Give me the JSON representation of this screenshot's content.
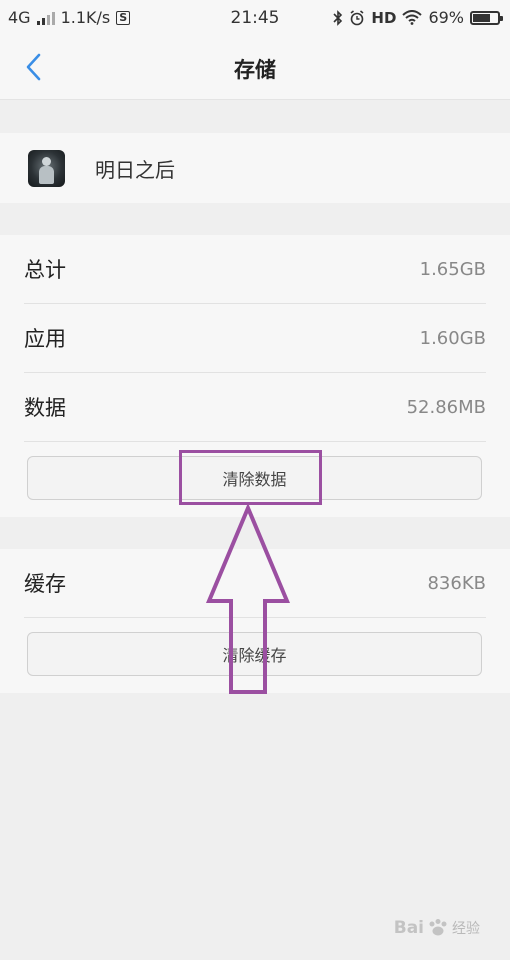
{
  "status_bar": {
    "network": "4G",
    "speed": "1.1K/s",
    "sync_glyph": "S",
    "time": "21:45",
    "hd": "HD",
    "battery_pct": "69%",
    "battery_level": 0.69
  },
  "nav": {
    "title": "存储"
  },
  "app": {
    "name": "明日之后"
  },
  "storage": {
    "rows": [
      {
        "label": "总计",
        "value": "1.65GB"
      },
      {
        "label": "应用",
        "value": "1.60GB"
      },
      {
        "label": "数据",
        "value": "52.86MB"
      }
    ],
    "clear_data_label": "清除数据"
  },
  "cache": {
    "label": "缓存",
    "value": "836KB",
    "clear_cache_label": "清除缓存"
  },
  "watermark": {
    "text": "Bai",
    "text2": "经验"
  },
  "colors": {
    "accent": "#3a8ee6",
    "annotation": "#9b4fa1"
  }
}
